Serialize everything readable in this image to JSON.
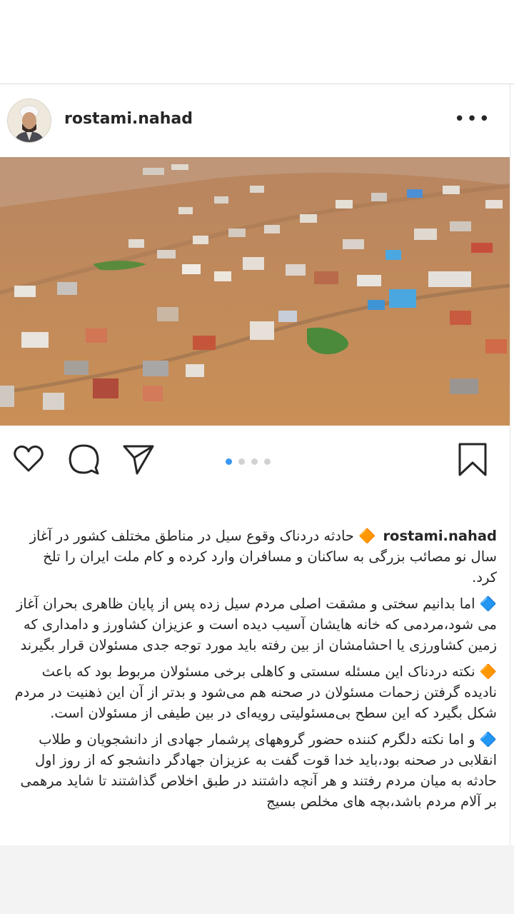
{
  "post": {
    "username": "rostami.nahad",
    "more_icon": "more-horizontal-icon",
    "image_alt": "aerial photo of flooded village",
    "carousel": {
      "count": 4,
      "active": 1
    },
    "actions": [
      "heart-icon",
      "comment-icon",
      "share-icon",
      "bookmark-icon"
    ],
    "colors": {
      "accent": "#3897f0",
      "flood": "#c48955",
      "text": "#262626"
    }
  },
  "caption": {
    "username": "rostami.nahad",
    "p1": "🔶 حادثه دردناک وقوع سیل در مناطق مختلف کشور در آغاز سال نو مصائب بزرگی به ساکنان و مسافران وارد کرده و کام ملت ایران را تلخ کرد.",
    "p2": "🔷 اما بدانیم سختی و مشقت اصلی مردم سیل زده پس از پایان ظاهری بحران آغاز می شود،مردمی که خانه هایشان آسیب دیده است و عزیزان کشاورز و دامداری که زمین کشاورزی یا احشامشان از بین رفته باید مورد توجه جدی مسئولان قرار بگیرند",
    "p3": "🔶 نکته دردناک این مسئله سستی و کاهلی برخی مسئولان مربوط بود که باعث نادیده گرفتن زحمات مسئولان در صحنه هم می‌شود و بدتر از آن این ذهنیت در مردم شکل بگیرد که این سطح بی‌مسئولیتی رویه‌ای در بین طیفی از مسئولان است.",
    "p4": "🔷 و اما نکته دلگرم کننده حضور گروههای پرشمار جهادی از دانشجویان و طلاب انقلابی در صحنه بود،باید خدا قوت گفت به عزیزان جهادگر دانشجو که از روز اول حادثه به میان مردم رفتند و هر آنچه داشتند در طبق اخلاص گذاشتند تا شاید مرهمی بر آلام مردم باشد،بچه های مخلص بسیج"
  }
}
